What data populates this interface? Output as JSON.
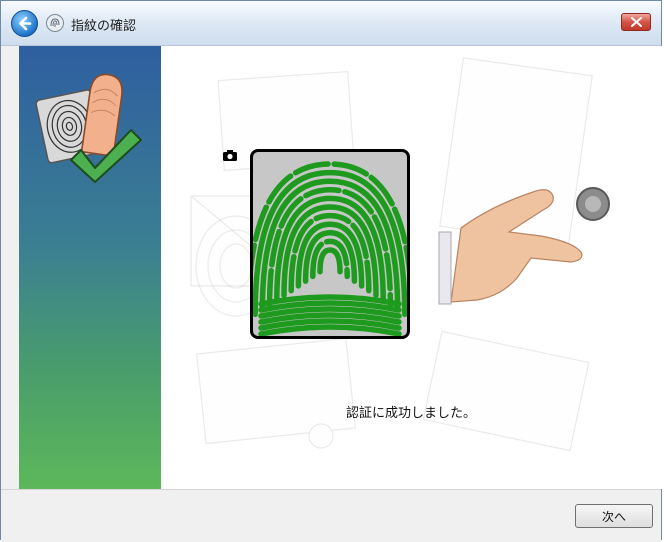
{
  "window": {
    "title": "指紋の確認",
    "back_icon": "back-arrow-icon",
    "title_icon": "fingerprint-icon",
    "close_icon": "close-icon"
  },
  "content": {
    "status_message": "認証に成功しました。",
    "scan_result_color": "#1e9a1e"
  },
  "footer": {
    "next_label": "次へ"
  },
  "colors": {
    "accent_green": "#4caf50",
    "sidebar_top": "#2e5fa0",
    "sidebar_bottom": "#5cb85a",
    "close_red": "#d3564a"
  }
}
